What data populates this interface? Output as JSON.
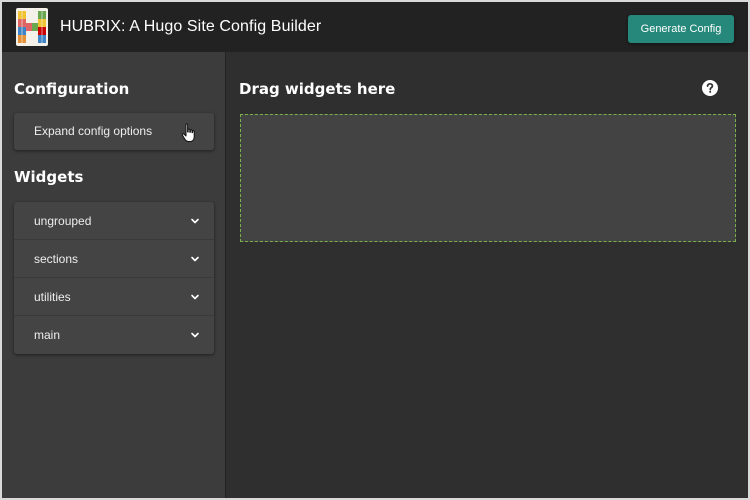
{
  "header": {
    "app_title": "HUBRIX: A Hugo Site Config Builder",
    "logo_icon": "lego-brick-h-logo",
    "generate_label": "Generate Config"
  },
  "sidebar": {
    "config_heading": "Configuration",
    "expand_label": "Expand config options",
    "widgets_heading": "Widgets",
    "groups": [
      {
        "label": "ungrouped",
        "icon": "chevron-down-icon"
      },
      {
        "label": "sections",
        "icon": "chevron-down-icon"
      },
      {
        "label": "utilities",
        "icon": "chevron-down-icon"
      },
      {
        "label": "main",
        "icon": "chevron-down-icon"
      }
    ]
  },
  "main": {
    "heading": "Drag widgets here",
    "help_icon": "help-circle-icon"
  },
  "colors": {
    "accent": "#26887a",
    "topbar": "#222222",
    "sidebar": "#3c3c3c",
    "main_bg": "#2f2f2f",
    "dropzone_border": "#7ab04a"
  }
}
